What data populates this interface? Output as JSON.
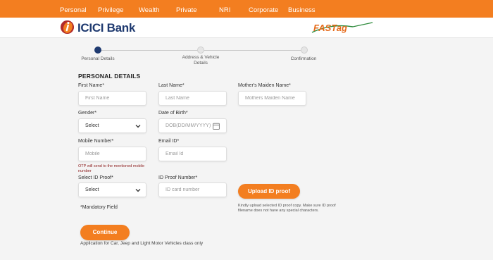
{
  "topnav": {
    "items": [
      "Personal",
      "Privilege",
      "Wealth",
      "Private",
      "NRI",
      "Corporate",
      "Business"
    ]
  },
  "brand": {
    "logo_text": "ICICI Bank",
    "partner_logo": "FASTag"
  },
  "stepper": {
    "steps": [
      {
        "label": "Personal Details",
        "state": "active"
      },
      {
        "label": "Address & Vehicle Details",
        "state": "pending"
      },
      {
        "label": "Confirmation",
        "state": "pending"
      }
    ]
  },
  "form": {
    "section_title": "PERSONAL DETAILS",
    "first_name": {
      "label": "First Name*",
      "placeholder": "First Name"
    },
    "last_name": {
      "label": "Last Name*",
      "placeholder": "Last Name"
    },
    "mother_name": {
      "label": "Mother's Maiden Name*",
      "placeholder": "Mothers Maiden Name"
    },
    "gender": {
      "label": "Gender*",
      "value": "Select"
    },
    "dob": {
      "label": "Date of Birth*",
      "placeholder": "DOB(DD/MM/YYYY)"
    },
    "mobile": {
      "label": "Mobile Number*",
      "placeholder": "Mobile"
    },
    "email": {
      "label": "Email ID*",
      "placeholder": "Email Id"
    },
    "otp_note": "OTP will send to the mentioned mobile number",
    "id_proof": {
      "label": "Select ID Proof*",
      "value": "Select"
    },
    "id_number": {
      "label": "ID Proof Number*",
      "placeholder": "ID card number"
    },
    "upload_label": "Upload ID proof",
    "upload_note": "Kindly upload selected ID proof copy. Make sure ID proof filename does not have any special characters.",
    "mandatory_note": "*Mandatory Field",
    "continue_label": "Continue",
    "footnote": "Application for Car, Jeep and Light Motor Vehicles class only"
  },
  "colors": {
    "accent": "#f37e20",
    "brand_navy": "#1f3a70",
    "otp_note": "#8b1a1a"
  }
}
